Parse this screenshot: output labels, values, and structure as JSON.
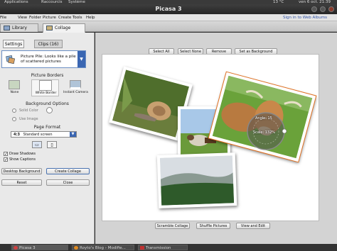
{
  "top_panel": {
    "applications": "Applications",
    "raccourcis": "Raccourcis",
    "systeme": "Système",
    "weather": "13 °C",
    "datetime": "ven 6 oct. 21:39"
  },
  "window": {
    "title": "Picasa 3"
  },
  "menu": {
    "items": [
      "File",
      "View",
      "Folder",
      "Picture",
      "Create",
      "Tools",
      "Help"
    ],
    "signin": "Sign in to Web Albums"
  },
  "tabs": {
    "library": "Library",
    "collage": "Collage"
  },
  "panel_tabs": {
    "settings": "Settings",
    "clips": "Clips (16)"
  },
  "collage_type": {
    "label": "Picture Pile: Looks like a pile of scattered pictures",
    "arrow": "▼"
  },
  "borders": {
    "heading": "Picture Borders",
    "options": [
      "None",
      "White Border",
      "Instant Camera"
    ]
  },
  "background": {
    "heading": "Background Options",
    "solid": "Solid Color",
    "use_image": "Use Image"
  },
  "page_format": {
    "heading": "Page Format",
    "ratio": "4:3",
    "name": "Standard screen",
    "arrow": "▼"
  },
  "checks": {
    "draw_shadows": "Draw Shadows",
    "show_captions": "Show Captions",
    "mark": "✓"
  },
  "buttons": {
    "desktop_bg": "Desktop Background",
    "create": "Create Collage",
    "reset": "Reset",
    "close": "Close"
  },
  "toolbar": {
    "select_all": "Select All",
    "select_none": "Select None",
    "remove": "Remove",
    "set_bg": "Set as Background"
  },
  "bottom_toolbar": {
    "scramble": "Scramble Collage",
    "shuffle": "Shuffle Pictures",
    "view_edit": "View and Edit"
  },
  "transform": {
    "angle": "Angle: 15",
    "scale": "Scale: 132%"
  },
  "taskbar": {
    "picasa": "Picasa 3",
    "firefox": "Royto's Blog › Modifie...",
    "transmission": "Transmission"
  }
}
